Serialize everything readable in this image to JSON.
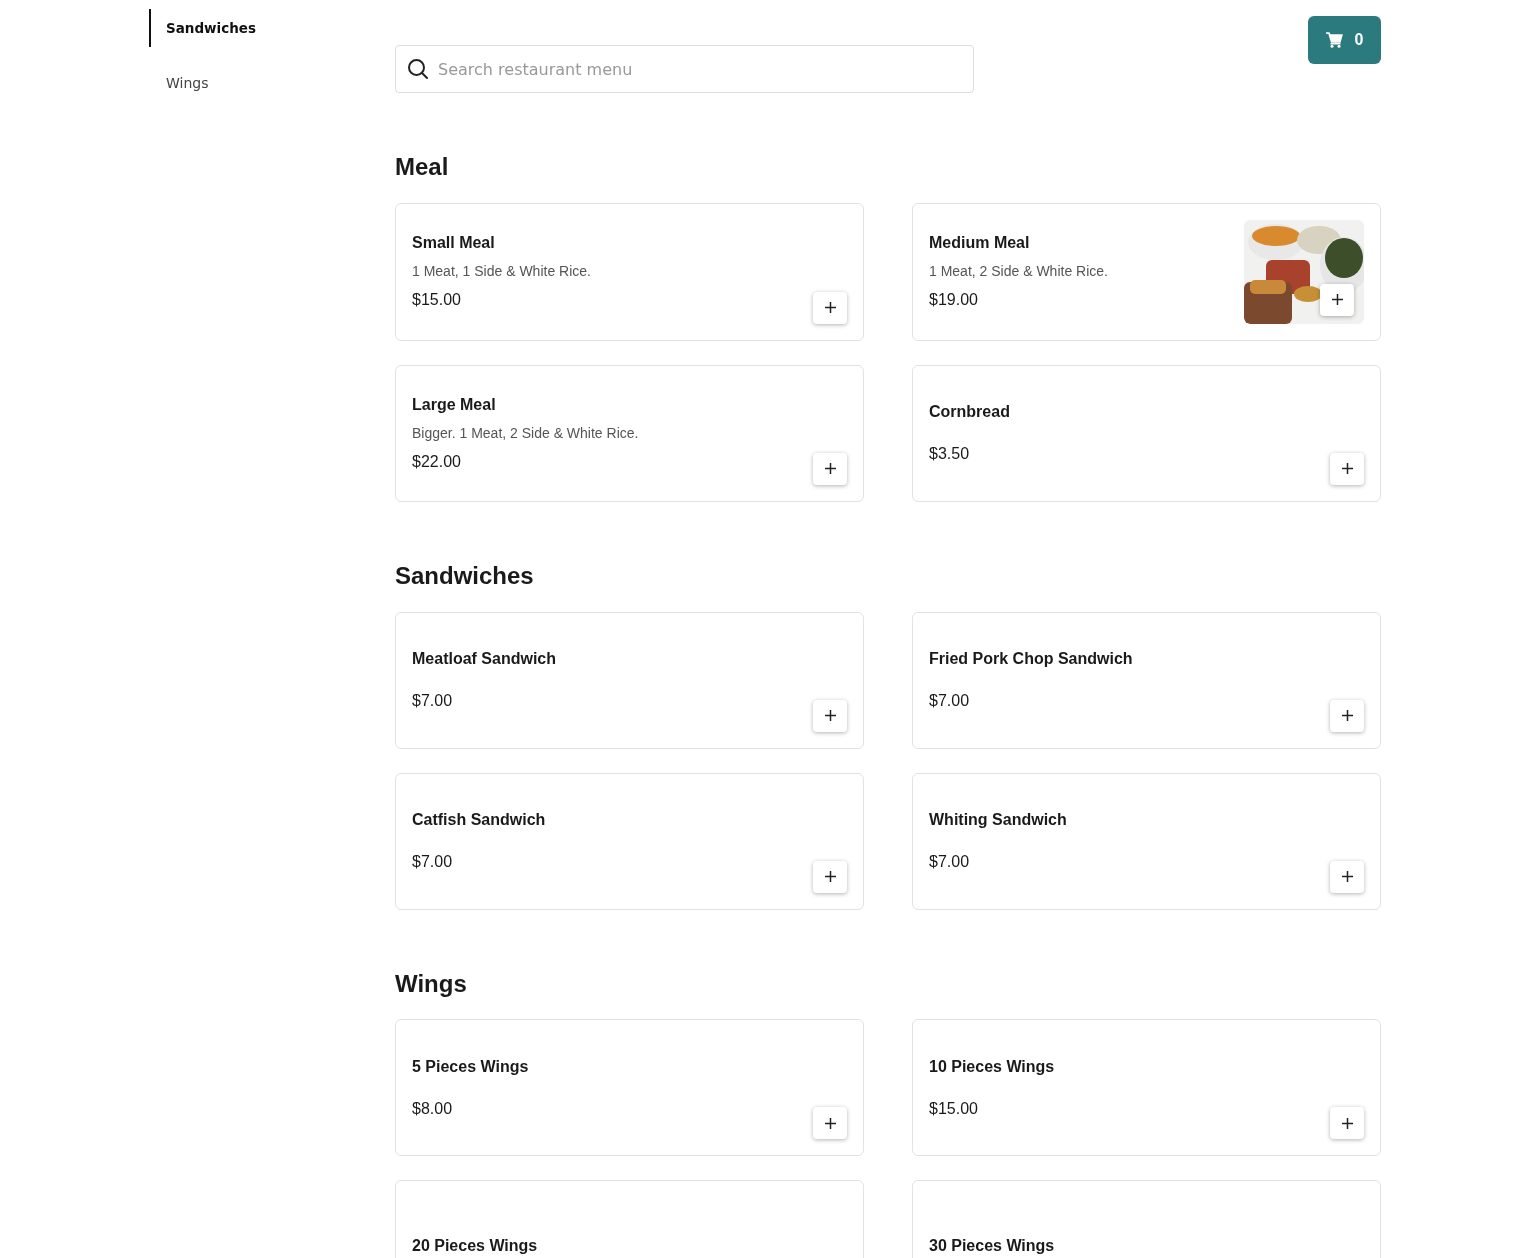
{
  "sidebar": {
    "items": [
      {
        "label": "Sandwiches",
        "selected": true
      },
      {
        "label": "Wings",
        "selected": false
      }
    ]
  },
  "search": {
    "placeholder": "Search restaurant menu"
  },
  "cart": {
    "count": "0"
  },
  "sections": [
    {
      "title": "Meal",
      "items": [
        {
          "name": "Small Meal",
          "description": "1 Meat, 1 Side & White Rice.",
          "price": "$15.00"
        },
        {
          "name": "Medium Meal",
          "description": "1 Meat, 2 Side & White Rice.",
          "price": "$19.00"
        },
        {
          "name": "Large Meal",
          "description": "Bigger. 1 Meat, 2 Side & White Rice.",
          "price": "$22.00"
        },
        {
          "name": "Cornbread",
          "price": "$3.50"
        }
      ]
    },
    {
      "title": "Sandwiches",
      "items": [
        {
          "name": "Meatloaf Sandwich",
          "price": "$7.00"
        },
        {
          "name": "Fried Pork Chop Sandwich",
          "price": "$7.00"
        },
        {
          "name": "Catfish Sandwich",
          "price": "$7.00"
        },
        {
          "name": "Whiting Sandwich",
          "price": "$7.00"
        }
      ]
    },
    {
      "title": "Wings",
      "items": [
        {
          "name": "5 Pieces Wings",
          "price": "$8.00"
        },
        {
          "name": "10 Pieces Wings",
          "price": "$15.00"
        },
        {
          "name": "20 Pieces Wings"
        },
        {
          "name": "30 Pieces Wings"
        }
      ]
    }
  ]
}
